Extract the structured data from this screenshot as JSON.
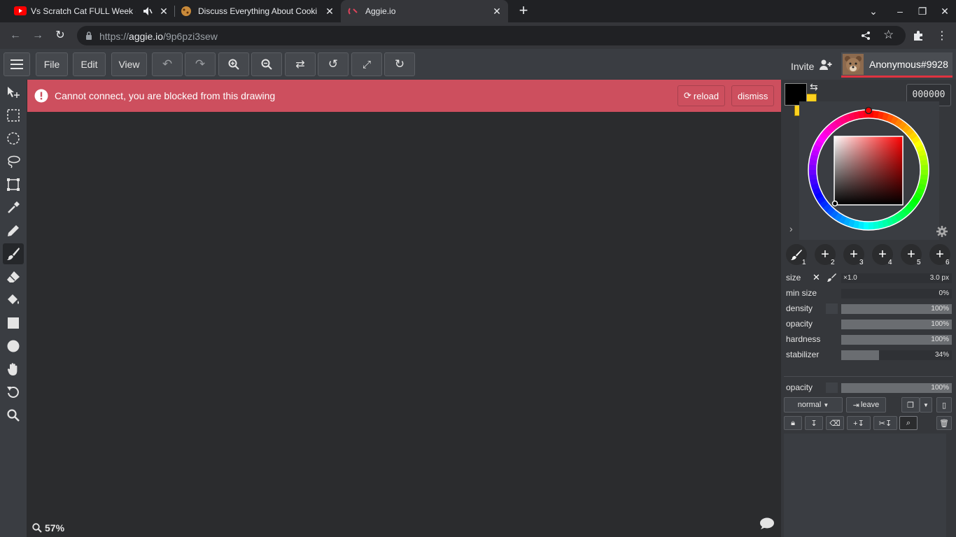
{
  "browser": {
    "tabs": [
      {
        "title": "Vs Scratch Cat FULL Week -",
        "muted": true
      },
      {
        "title": "Discuss Everything About Cooki"
      },
      {
        "title": "Aggie.io",
        "active": true
      }
    ],
    "url_prefix": "https://",
    "url_host": "aggie.io",
    "url_path": "/9p6pzi3sew"
  },
  "appbar": {
    "file_label": "File",
    "edit_label": "Edit",
    "view_label": "View",
    "invite_label": "Invite",
    "user_name": "Anonymous#9928"
  },
  "error": {
    "message": "Cannot connect, you are blocked from this drawing",
    "reload_label": "reload",
    "dismiss_label": "dismiss"
  },
  "canvas": {
    "zoom": "57%"
  },
  "color": {
    "hex": "000000",
    "primary": "#000000",
    "secondary": "#ffd21f"
  },
  "brush_slots": [
    "1",
    "2",
    "3",
    "4",
    "5",
    "6"
  ],
  "brush": {
    "size_label": "size",
    "size_mult": "×1.0",
    "size_value": "3.0 px",
    "min_size_label": "min size",
    "min_size_value": "0%",
    "density_label": "density",
    "density_value": "100%",
    "opacity_label": "opacity",
    "opacity_value": "100%",
    "hardness_label": "hardness",
    "hardness_value": "100%",
    "stabilizer_label": "stabilizer",
    "stabilizer_value": "34%"
  },
  "layer": {
    "opacity_label": "opacity",
    "opacity_value": "100%",
    "blend_mode": "normal",
    "leave_label": "leave"
  }
}
